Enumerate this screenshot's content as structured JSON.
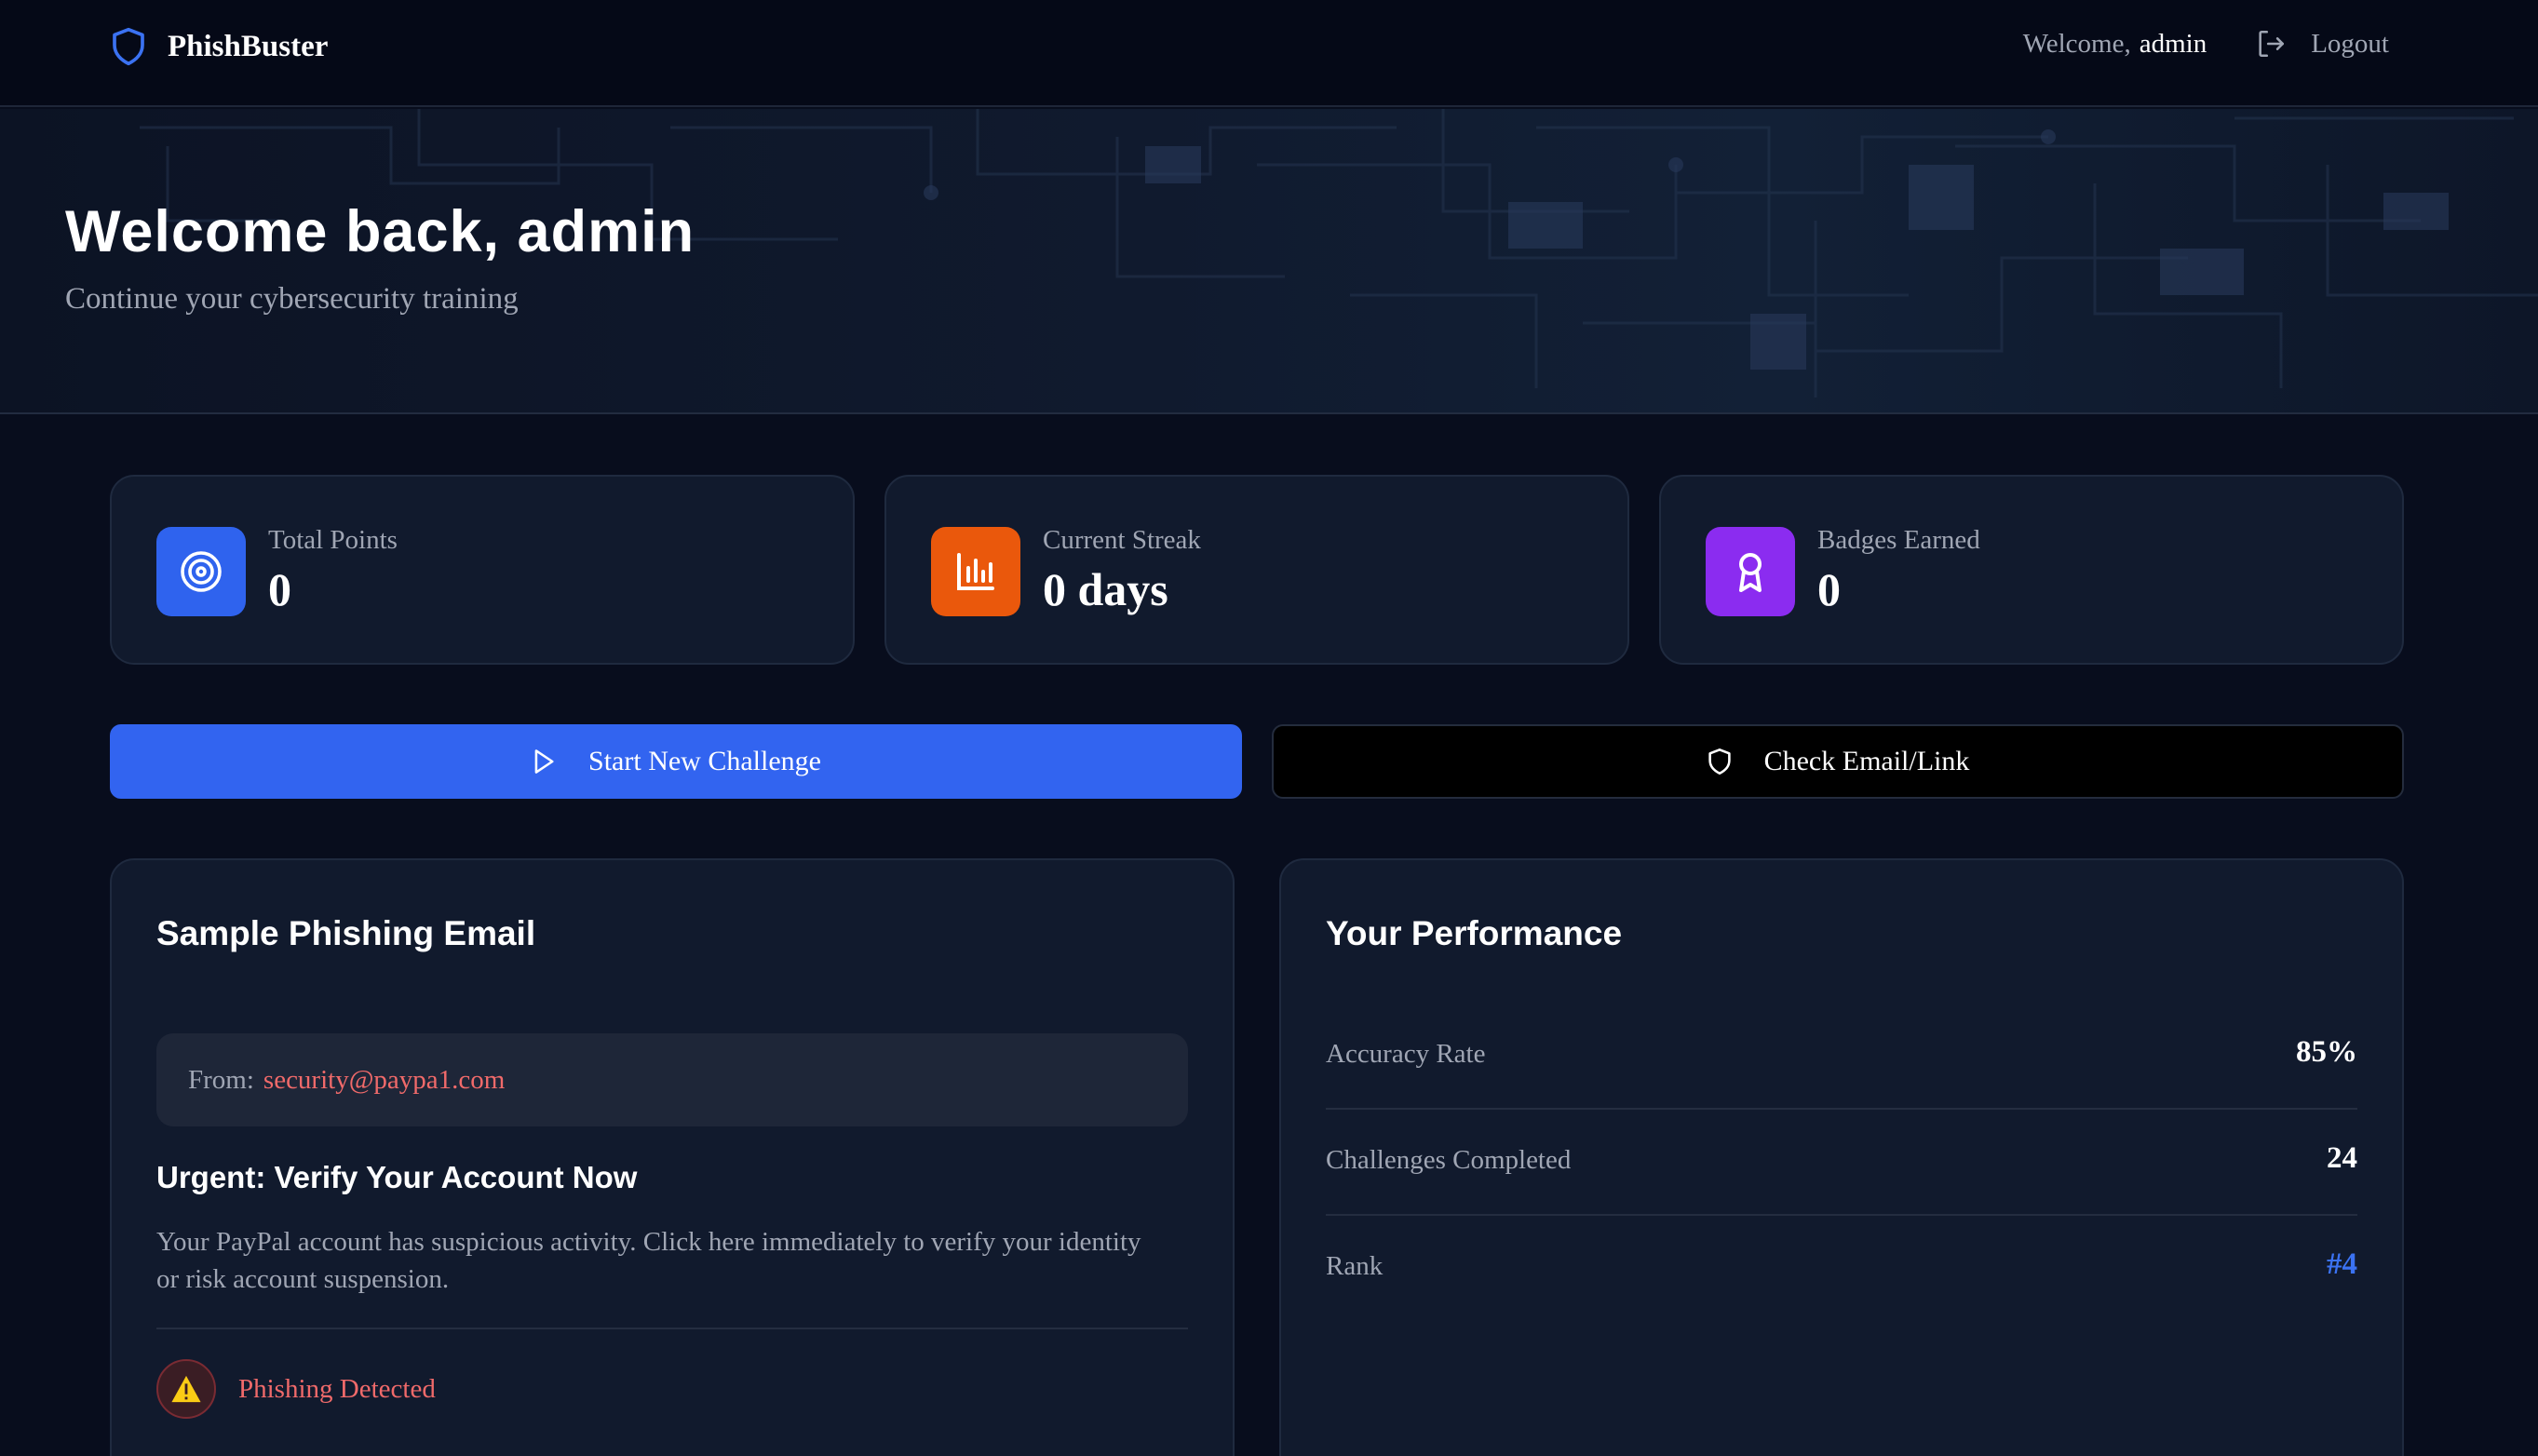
{
  "app": {
    "name": "PhishBuster"
  },
  "nav": {
    "welcome_prefix": "Welcome,",
    "username": "admin",
    "logout_label": "Logout"
  },
  "hero": {
    "title": "Welcome back, admin",
    "subtitle": "Continue your cybersecurity training"
  },
  "stats": [
    {
      "label": "Total Points",
      "value": "0",
      "icon": "target-icon",
      "color": "#2f63ee"
    },
    {
      "label": "Current Streak",
      "value": "0 days",
      "icon": "bar-chart-icon",
      "color": "#ea580c"
    },
    {
      "label": "Badges Earned",
      "value": "0",
      "icon": "award-icon",
      "color": "#8b2cf0"
    }
  ],
  "actions": {
    "start_challenge": "Start New Challenge",
    "check_email": "Check Email/Link"
  },
  "sample_email": {
    "title": "Sample Phishing Email",
    "from_label": "From:",
    "from_address": "security@paypa1.com",
    "subject": "Urgent: Verify Your Account Now",
    "body": "Your PayPal account has suspicious activity. Click here immediately to verify your identity or risk account suspension.",
    "verdict": "Phishing Detected"
  },
  "performance": {
    "title": "Your Performance",
    "rows": [
      {
        "label": "Accuracy Rate",
        "value": "85%"
      },
      {
        "label": "Challenges Completed",
        "value": "24"
      },
      {
        "label": "Rank",
        "value": "#4"
      }
    ]
  },
  "colors": {
    "accent_blue": "#3264f0",
    "danger_red": "#f06a6a",
    "rank_blue": "#3b72f2",
    "background": "#080d1d"
  }
}
